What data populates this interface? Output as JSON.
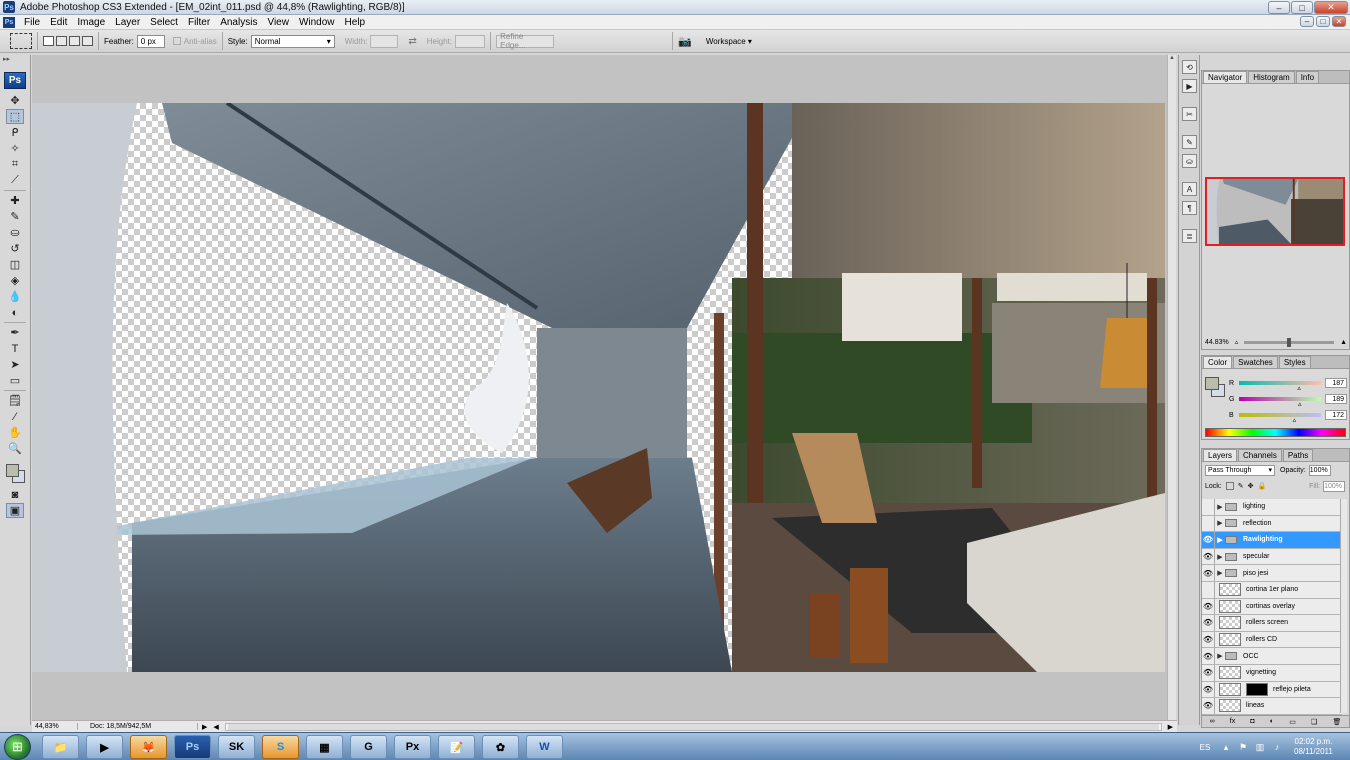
{
  "window": {
    "title": "Adobe Photoshop CS3 Extended - [EM_02int_011.psd @ 44,8% (Rawlighting, RGB/8)]",
    "app_icon": "Ps",
    "minimize_glyph": "–",
    "maximize_glyph": "□",
    "close_glyph": "✕"
  },
  "menu": [
    "File",
    "Edit",
    "Image",
    "Layer",
    "Select",
    "Filter",
    "Analysis",
    "View",
    "Window",
    "Help"
  ],
  "options": {
    "feather_label": "Feather:",
    "feather_value": "0 px",
    "anti_alias_label": "Anti-alias",
    "style_label": "Style:",
    "style_value": "Normal",
    "width_label": "Width:",
    "height_label": "Height:",
    "refine_edge_label": "Refine Edge...",
    "workspace_label": "Workspace ▾"
  },
  "tools_logo": "Ps",
  "status": {
    "zoom": "44,83%",
    "doc": "Doc: 18,5M/942,5M"
  },
  "navigator": {
    "tabs": [
      "Navigator",
      "Histogram",
      "Info"
    ],
    "zoom": "44.83%"
  },
  "color_panel": {
    "tabs": [
      "Color",
      "Swatches",
      "Styles"
    ],
    "fg_color": "#bbbdac",
    "channels": [
      {
        "label": "R",
        "value": "187",
        "fraction": 0.733
      },
      {
        "label": "G",
        "value": "189",
        "fraction": 0.741
      },
      {
        "label": "B",
        "value": "172",
        "fraction": 0.675
      }
    ]
  },
  "layers_panel": {
    "tabs": [
      "Layers",
      "Channels",
      "Paths"
    ],
    "blend_mode": "Pass Through",
    "opacity_label": "Opacity:",
    "opacity_value": "100%",
    "lock_label": "Lock:",
    "fill_label": "Fill:",
    "fill_value": "100%",
    "layers": [
      {
        "name": "lighting",
        "type": "group",
        "visible": false,
        "selected": false
      },
      {
        "name": "reflection",
        "type": "group",
        "visible": false,
        "selected": false
      },
      {
        "name": "Rawlighting",
        "type": "group",
        "visible": true,
        "selected": true
      },
      {
        "name": "specular",
        "type": "group",
        "visible": true,
        "selected": false
      },
      {
        "name": "piso jesi",
        "type": "group",
        "visible": true,
        "selected": false
      },
      {
        "name": "cortina 1er plano",
        "type": "layer",
        "visible": false,
        "selected": false
      },
      {
        "name": "cortinas overlay",
        "type": "layer",
        "visible": true,
        "selected": false
      },
      {
        "name": "rollers screen",
        "type": "layer",
        "visible": true,
        "selected": false
      },
      {
        "name": "rollers CD",
        "type": "layer",
        "visible": true,
        "selected": false
      },
      {
        "name": "OCC",
        "type": "group",
        "visible": true,
        "selected": false
      },
      {
        "name": "vignetting",
        "type": "layer",
        "visible": true,
        "selected": false
      },
      {
        "name": "reflejo pileta",
        "type": "masked",
        "visible": true,
        "selected": false
      },
      {
        "name": "lineas",
        "type": "layer",
        "visible": true,
        "selected": false
      }
    ]
  },
  "taskbar": {
    "apps": [
      "📁",
      "▶",
      "🦊",
      "Ps",
      "SK",
      "S",
      "▦",
      "G",
      "Px",
      "📝",
      "✿",
      "W"
    ],
    "language": "ES",
    "time": "02:02 p.m.",
    "date": "08/11/2011"
  }
}
